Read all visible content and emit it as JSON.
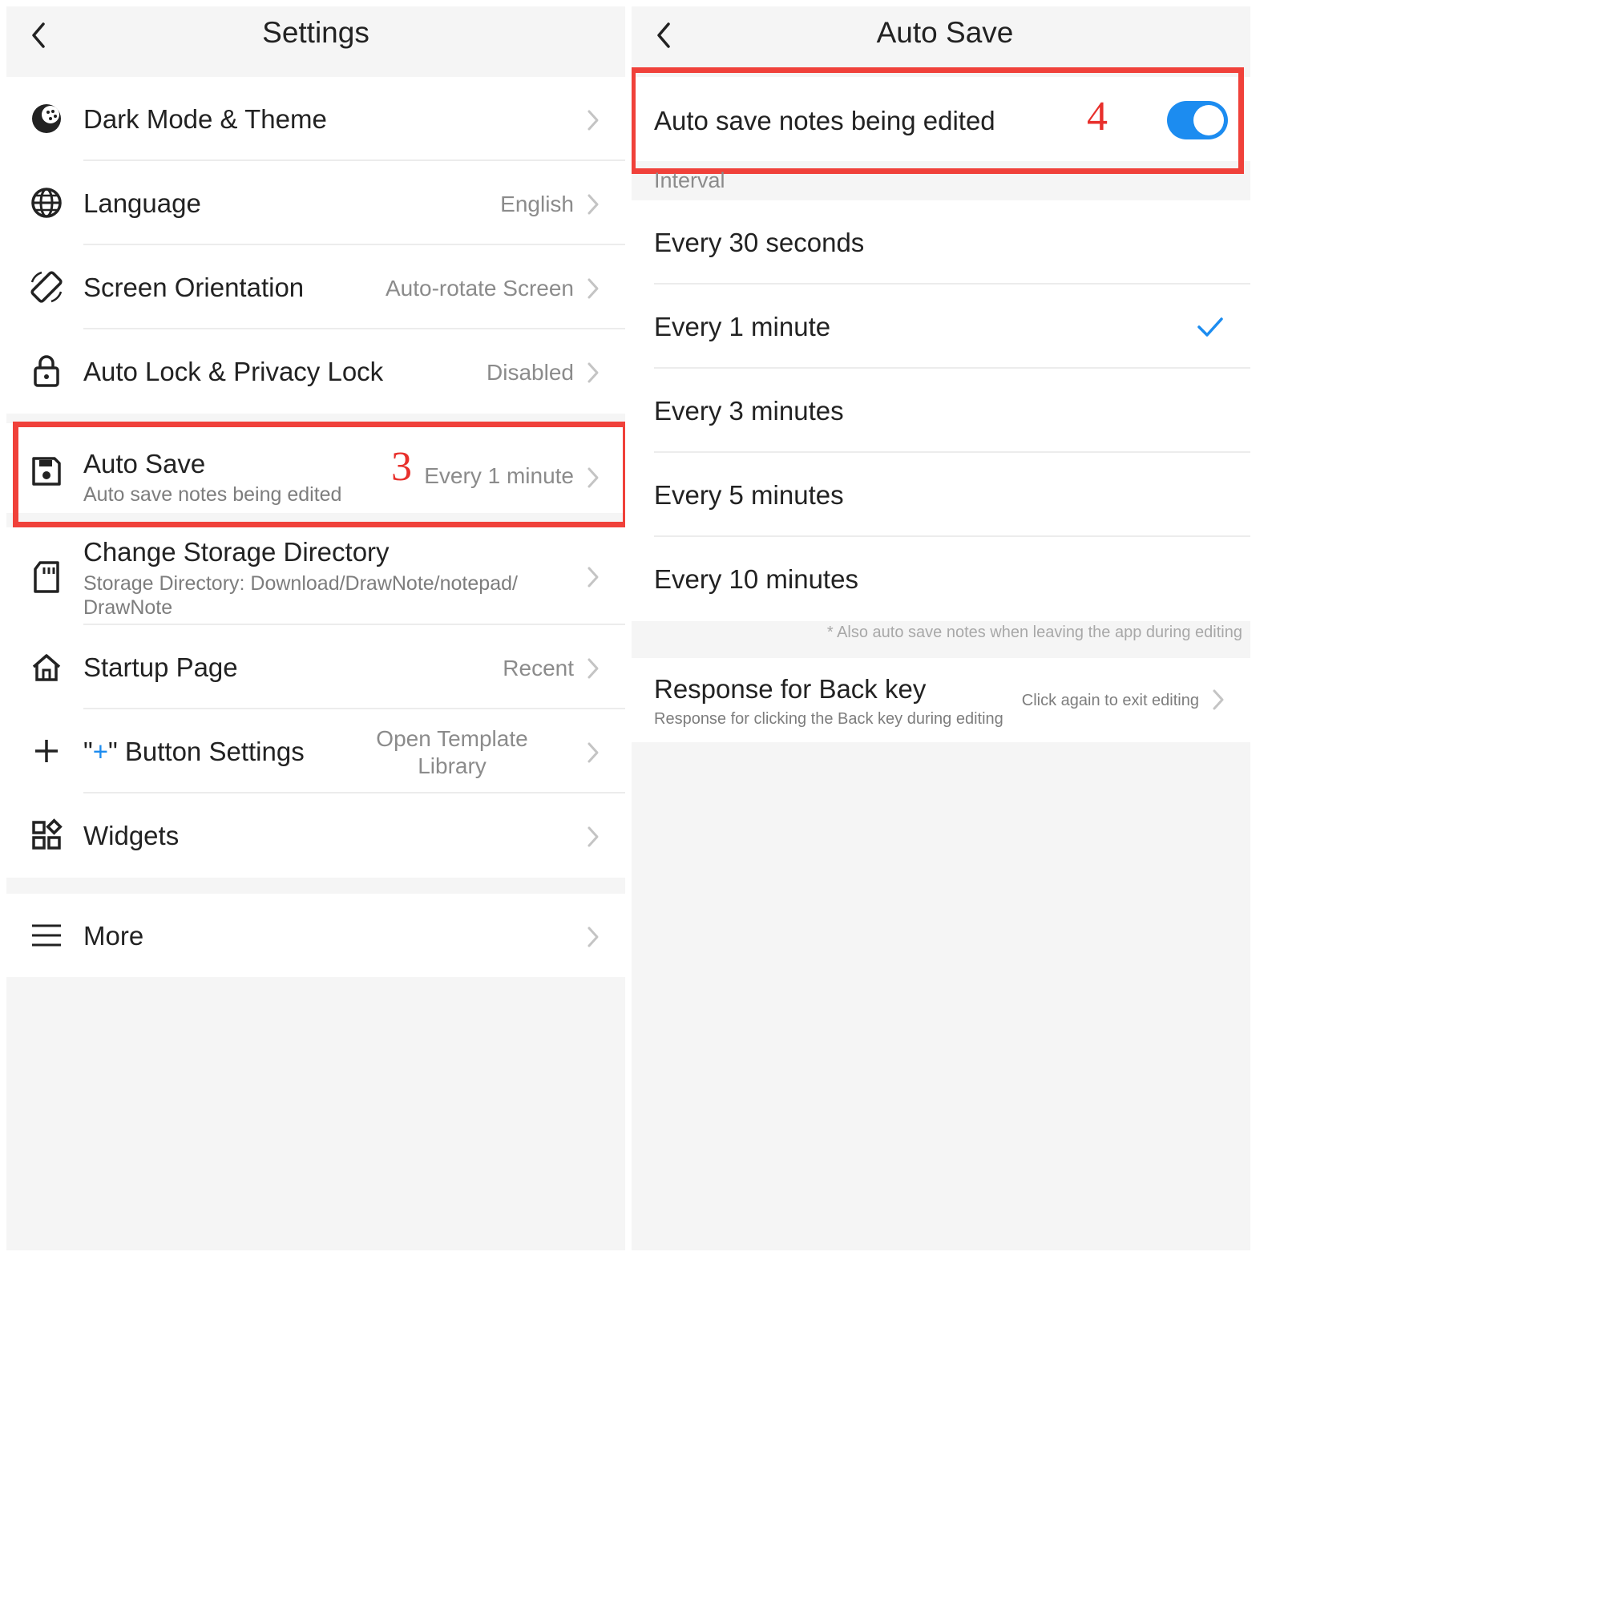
{
  "settings": {
    "title": "Settings",
    "items": [
      {
        "label": "Dark Mode & Theme",
        "value": "",
        "icon": "palette-icon"
      },
      {
        "label": "Language",
        "value": "English",
        "icon": "globe-icon"
      },
      {
        "label": "Screen Orientation",
        "value": "Auto-rotate Screen",
        "icon": "rotate-screen-icon"
      },
      {
        "label": "Auto Lock & Privacy Lock",
        "value": "Disabled",
        "icon": "lock-icon"
      },
      {
        "label": "Auto Save",
        "sublabel": "Auto save notes being edited",
        "value": "Every 1 minute",
        "icon": "save-icon"
      },
      {
        "label": "Change Storage Directory",
        "sublabel_line1": "Storage Directory: Download/DrawNote/notepad/",
        "sublabel_line2": "DrawNote",
        "icon": "sd-card-icon"
      },
      {
        "label": "Startup Page",
        "value": "Recent",
        "icon": "home-icon"
      },
      {
        "label_prefix": "\"",
        "label_plus": "+",
        "label_suffix": "\" Button Settings",
        "value_line1": "Open Template",
        "value_line2": "Library",
        "icon": "plus-icon"
      },
      {
        "label": "Widgets",
        "icon": "widgets-icon"
      },
      {
        "label": "More",
        "icon": "menu-icon"
      }
    ],
    "step_marker": "3"
  },
  "auto_save": {
    "title": "Auto Save",
    "toggle_label": "Auto save notes being edited",
    "toggle_on": true,
    "step_marker": "4",
    "interval_header": "Interval",
    "options": [
      {
        "label": "Every 30 seconds",
        "selected": false
      },
      {
        "label": "Every 1 minute",
        "selected": true
      },
      {
        "label": "Every 3 minutes",
        "selected": false
      },
      {
        "label": "Every 5 minutes",
        "selected": false
      },
      {
        "label": "Every 10 minutes",
        "selected": false
      }
    ],
    "footnote": "* Also auto save notes when leaving the app during editing",
    "back_key": {
      "label": "Response for Back key",
      "sublabel": "Response for clicking the Back key during editing",
      "value": "Click again to exit editing"
    }
  },
  "colors": {
    "accent": "#1c8cf0",
    "highlight": "#f0413a"
  }
}
